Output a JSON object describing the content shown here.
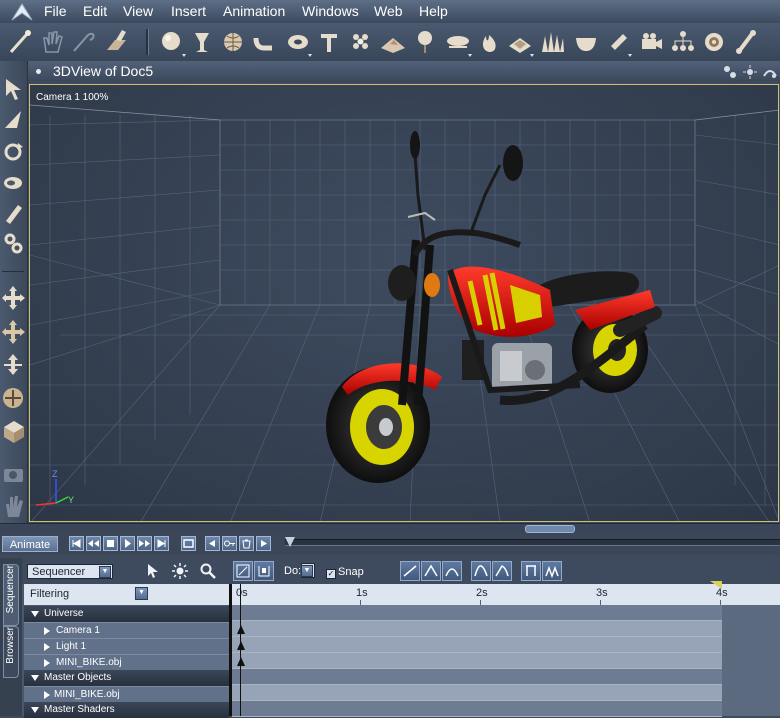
{
  "menubar": {
    "items": [
      "File",
      "Edit",
      "View",
      "Insert",
      "Animation",
      "Windows",
      "Web",
      "Help"
    ]
  },
  "view": {
    "title": "3DView of Doc5",
    "camera_label": "Camera 1 100%"
  },
  "animation": {
    "animate_label": "Animate"
  },
  "sequencer": {
    "mode": "Sequencer",
    "filtering_label": "Filtering",
    "do_label": "Do:",
    "snap_label": "Snap",
    "snap_checked": true,
    "tabs": [
      "Sequencer",
      "Browser"
    ],
    "ruler_ticks": [
      "0s",
      "1s",
      "2s",
      "3s",
      "4s"
    ],
    "tree": [
      {
        "label": "Universe",
        "type": "group"
      },
      {
        "label": "Camera 1",
        "type": "item",
        "keyframe": true
      },
      {
        "label": "Light 1",
        "type": "item",
        "keyframe": true
      },
      {
        "label": "MINI_BIKE.obj",
        "type": "item",
        "keyframe": true
      },
      {
        "label": "Master Objects",
        "type": "group"
      },
      {
        "label": "MINI_BIKE.obj",
        "type": "item",
        "keyframe": false
      },
      {
        "label": "Master Shaders",
        "type": "group"
      }
    ]
  },
  "colors": {
    "accent": "#d9d25a",
    "bike_body": "#e01010",
    "rim": "#d8d400"
  }
}
